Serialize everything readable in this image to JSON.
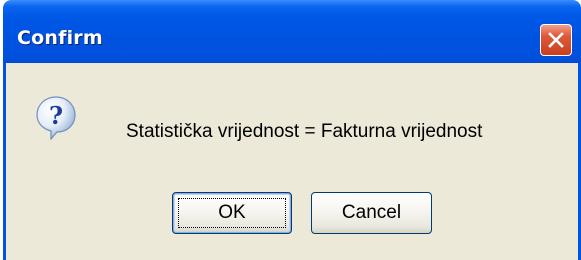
{
  "dialog": {
    "title": "Confirm",
    "message": "Statistička vrijednost = Fakturna vrijednost",
    "icon": "question-icon",
    "buttons": {
      "ok_label": "OK",
      "cancel_label": "Cancel"
    }
  },
  "colors": {
    "title_bar": "#0054E3",
    "face": "#ECE9D8",
    "close": "#E05A3A"
  }
}
